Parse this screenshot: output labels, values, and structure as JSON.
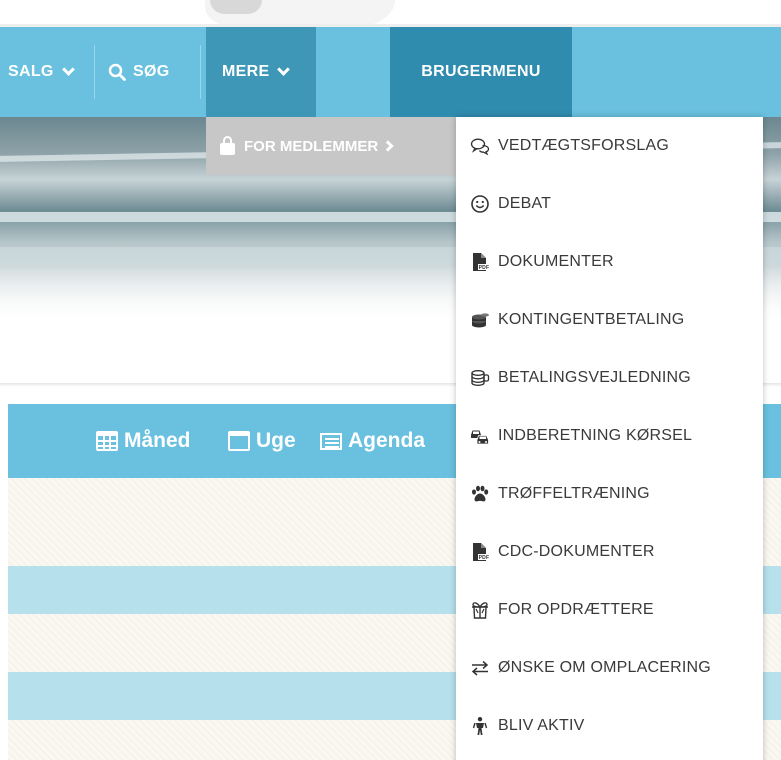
{
  "nav": {
    "salg_label": "SALG",
    "soeg_label": "SØG",
    "mere_label": "MERE",
    "brugermenu_label": "BRUGERMENU"
  },
  "submenu": {
    "for_medlemmer_label": "FOR MEDLEMMER"
  },
  "dropdown": {
    "items": [
      {
        "label": "VEDTÆGTSFORSLAG",
        "icon": "comments-icon"
      },
      {
        "label": "DEBAT",
        "icon": "smile-icon"
      },
      {
        "label": "DOKUMENTER",
        "icon": "pdf-file-icon"
      },
      {
        "label": "KONTINGENTBETALING",
        "icon": "coins-icon"
      },
      {
        "label": "BETALINGSVEJLEDNING",
        "icon": "coins-outline-icon"
      },
      {
        "label": "INDBERETNING KØRSEL",
        "icon": "cars-icon"
      },
      {
        "label": "TRØFFELTRÆNING",
        "icon": "paw-icon"
      },
      {
        "label": "CDC-DOKUMENTER",
        "icon": "pdf-file-icon"
      },
      {
        "label": "FOR OPDRÆTTERE",
        "icon": "gift-icon"
      },
      {
        "label": "ØNSKE OM OMPLACERING",
        "icon": "exchange-icon"
      },
      {
        "label": "BLIV AKTIV",
        "icon": "person-icon"
      }
    ]
  },
  "calendar": {
    "views": {
      "maaned": "Måned",
      "uge": "Uge",
      "agenda": "Agenda"
    }
  },
  "colors": {
    "nav_bg": "#69c1df",
    "nav_active": "#3f97b7",
    "brugermenu_bg": "#2f8caf",
    "submenu_bg": "#c7c7c7",
    "row_blue": "#b5e0ec"
  }
}
